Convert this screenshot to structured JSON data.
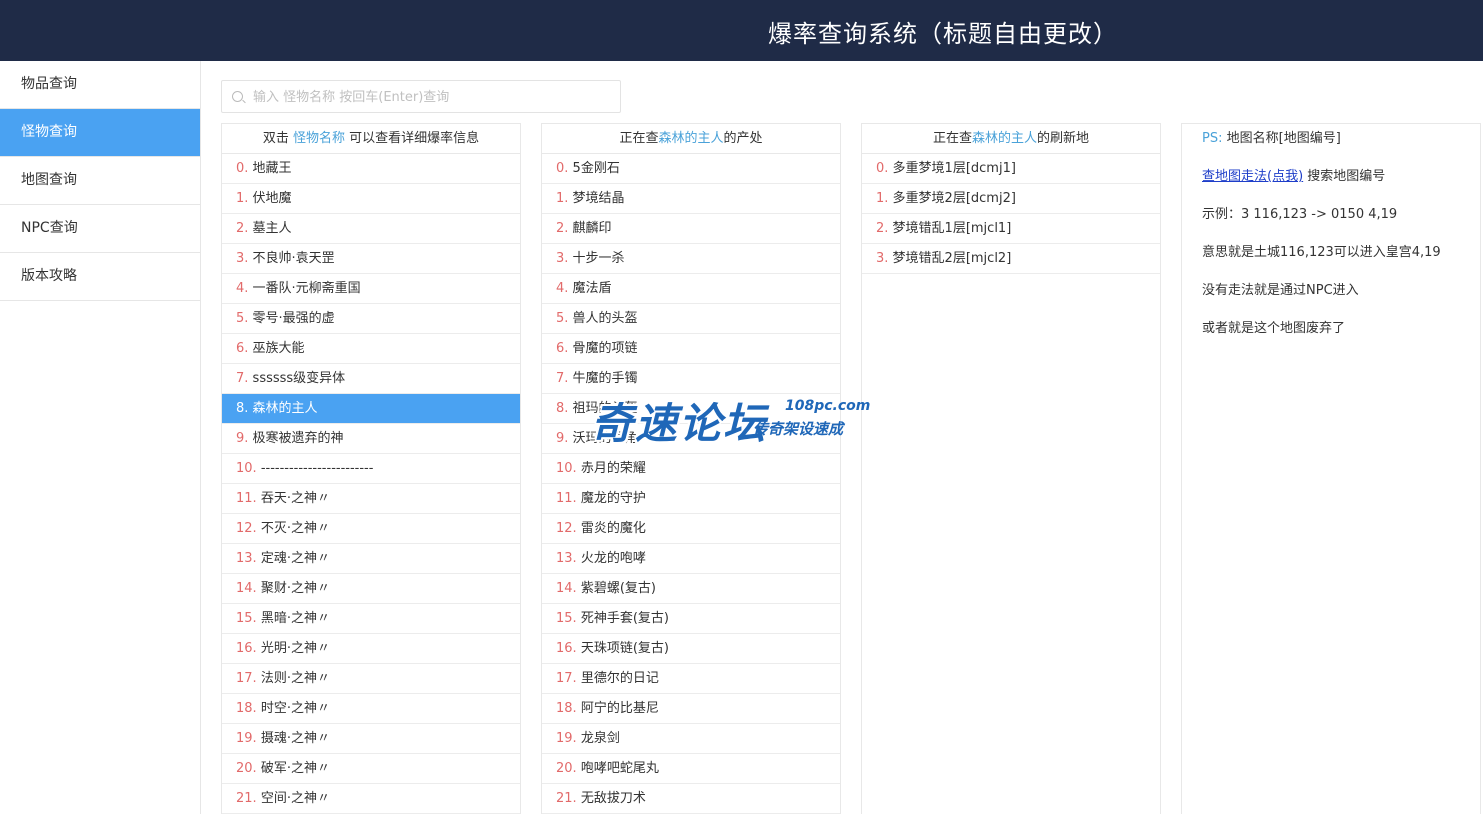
{
  "header": {
    "title": "爆率查询系统（标题自由更改）"
  },
  "sidebar": {
    "items": [
      {
        "label": "物品查询",
        "active": false
      },
      {
        "label": "怪物查询",
        "active": true
      },
      {
        "label": "地图查询",
        "active": false
      },
      {
        "label": "NPC查询",
        "active": false
      },
      {
        "label": "版本攻略",
        "active": false
      }
    ]
  },
  "search": {
    "placeholder": "输入 怪物名称 按回车(Enter)查询",
    "value": ""
  },
  "monsters": {
    "head_prefix": "双击 ",
    "head_highlight": "怪物名称",
    "head_suffix": " 可以查看详细爆率信息",
    "selected_index": 8,
    "items": [
      {
        "idx": "0.",
        "name": "地藏王"
      },
      {
        "idx": "1.",
        "name": "伏地魔"
      },
      {
        "idx": "2.",
        "name": "墓主人"
      },
      {
        "idx": "3.",
        "name": "不良帅·袁天罡"
      },
      {
        "idx": "4.",
        "name": "一番队·元柳斋重国"
      },
      {
        "idx": "5.",
        "name": "零号·最强的虚"
      },
      {
        "idx": "6.",
        "name": "巫族大能"
      },
      {
        "idx": "7.",
        "name": "ssssss级变异体"
      },
      {
        "idx": "8.",
        "name": "森林的主人"
      },
      {
        "idx": "9.",
        "name": "极寒被遗弃的神"
      },
      {
        "idx": "10.",
        "name": "------------------------"
      },
      {
        "idx": "11.",
        "name": "吞天·之神〃"
      },
      {
        "idx": "12.",
        "name": "不灭·之神〃"
      },
      {
        "idx": "13.",
        "name": "定魂·之神〃"
      },
      {
        "idx": "14.",
        "name": "聚财·之神〃"
      },
      {
        "idx": "15.",
        "name": "黑暗·之神〃"
      },
      {
        "idx": "16.",
        "name": "光明·之神〃"
      },
      {
        "idx": "17.",
        "name": "法则·之神〃"
      },
      {
        "idx": "18.",
        "name": "时空·之神〃"
      },
      {
        "idx": "19.",
        "name": "摄魂·之神〃"
      },
      {
        "idx": "20.",
        "name": "破军·之神〃"
      },
      {
        "idx": "21.",
        "name": "空间·之神〃"
      }
    ]
  },
  "drops": {
    "head_prefix": "正在查",
    "head_highlight": "森林的主人",
    "head_suffix": "的产处",
    "items": [
      {
        "idx": "0.",
        "name": "5金刚石"
      },
      {
        "idx": "1.",
        "name": "梦境结晶"
      },
      {
        "idx": "2.",
        "name": "麒麟印"
      },
      {
        "idx": "3.",
        "name": "十步一杀"
      },
      {
        "idx": "4.",
        "name": "魔法盾"
      },
      {
        "idx": "5.",
        "name": "兽人的头盔"
      },
      {
        "idx": "6.",
        "name": "骨魔的项链"
      },
      {
        "idx": "7.",
        "name": "牛魔的手镯"
      },
      {
        "idx": "8.",
        "name": "祖玛的头盔"
      },
      {
        "idx": "9.",
        "name": "沃玛的号角"
      },
      {
        "idx": "10.",
        "name": "赤月的荣耀"
      },
      {
        "idx": "11.",
        "name": "魔龙的守护"
      },
      {
        "idx": "12.",
        "name": "雷炎的魔化"
      },
      {
        "idx": "13.",
        "name": "火龙的咆哮"
      },
      {
        "idx": "14.",
        "name": "紫碧螺(复古)"
      },
      {
        "idx": "15.",
        "name": "死神手套(复古)"
      },
      {
        "idx": "16.",
        "name": "天珠项链(复古)"
      },
      {
        "idx": "17.",
        "name": "里德尔的日记"
      },
      {
        "idx": "18.",
        "name": "阿宁的比基尼"
      },
      {
        "idx": "19.",
        "name": "龙泉剑"
      },
      {
        "idx": "20.",
        "name": "咆哮吧蛇尾丸"
      },
      {
        "idx": "21.",
        "name": "无敌拔刀术"
      }
    ]
  },
  "spawns": {
    "head_prefix": "正在查",
    "head_highlight": "森林的主人",
    "head_suffix": "的刷新地",
    "items": [
      {
        "idx": "0.",
        "name": "多重梦境1层[dcmj1]"
      },
      {
        "idx": "1.",
        "name": "多重梦境2层[dcmj2]"
      },
      {
        "idx": "2.",
        "name": "梦境错乱1层[mjcl1]"
      },
      {
        "idx": "3.",
        "name": "梦境错乱2层[mjcl2]"
      }
    ]
  },
  "info": {
    "ps_label": "PS:",
    "ps_text": "地图名称[地图编号]",
    "link_text": "查地图走法(点我)",
    "link_suffix": " 搜索地图编号",
    "example": "示例：3 116,123 -> 0150 4,19",
    "meaning": "意思就是土城116,123可以进入皇宫4,19",
    "npc_note": "没有走法就是通过NPC进入",
    "abandoned": "或者就是这个地图废弃了"
  },
  "watermark": {
    "cn": "奇速论坛",
    "en": "108pc.com",
    "sub": "传奇架设速成"
  },
  "colors": {
    "header_bg": "#1f2b47",
    "accent": "#4aa2f2",
    "index": "#e26a6a",
    "highlight": "#4aa2d9"
  }
}
